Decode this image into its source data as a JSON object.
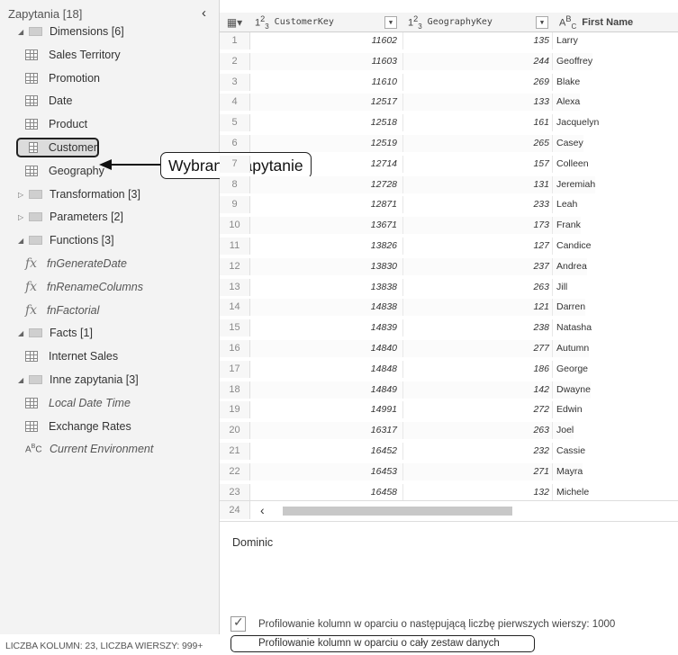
{
  "pane": {
    "title": "Zapytania [18]",
    "collapse_icon": "chevron-left-icon",
    "tree": [
      {
        "id": "dimensions",
        "label": "Dimensions [6]",
        "kind": "folder",
        "arrow": "expanded",
        "level": 0
      },
      {
        "id": "sales-territory",
        "label": "Sales Territory",
        "kind": "table",
        "level": 1
      },
      {
        "id": "promotion",
        "label": "Promotion",
        "kind": "table",
        "level": 1
      },
      {
        "id": "date",
        "label": "Date",
        "kind": "table",
        "level": 1
      },
      {
        "id": "product",
        "label": "Product",
        "kind": "table",
        "level": 1
      },
      {
        "id": "customer",
        "label": "Customer",
        "kind": "table",
        "level": 1,
        "selected": true
      },
      {
        "id": "geography",
        "label": "Geography",
        "kind": "table",
        "level": 1
      },
      {
        "id": "transformation",
        "label": "Transformation [3]",
        "kind": "folder",
        "arrow": "collapsed",
        "level": 0
      },
      {
        "id": "parameters",
        "label": "Parameters [2]",
        "kind": "folder",
        "arrow": "collapsed",
        "level": 0
      },
      {
        "id": "functions",
        "label": "Functions [3]",
        "kind": "folder",
        "arrow": "expanded",
        "level": 0
      },
      {
        "id": "fngeneratedate",
        "label": "fnGenerateDate",
        "kind": "function",
        "level": 1,
        "italic": true
      },
      {
        "id": "fnrenamecolumns",
        "label": "fnRenameColumns",
        "kind": "function",
        "level": 1,
        "italic": true
      },
      {
        "id": "fnfactorial",
        "label": "fnFactorial",
        "kind": "function",
        "level": 1,
        "italic": true
      },
      {
        "id": "facts",
        "label": "Facts [1]",
        "kind": "folder",
        "arrow": "expanded",
        "level": 0
      },
      {
        "id": "internet-sales",
        "label": "Internet Sales",
        "kind": "table",
        "level": 1
      },
      {
        "id": "inne-zapytania",
        "label": "Inne zapytania [3]",
        "kind": "folder",
        "arrow": "expanded",
        "level": 0
      },
      {
        "id": "local-date-time",
        "label": "Local Date Time",
        "kind": "table",
        "level": 1,
        "italic": true
      },
      {
        "id": "exchange-rates",
        "label": "Exchange Rates",
        "kind": "table",
        "level": 1
      },
      {
        "id": "current-environment",
        "label": "Current Environment",
        "kind": "text",
        "level": 1,
        "italic": true
      }
    ],
    "callout": "Wybrane zapytanie",
    "status": "LICZBA KOLUMN: 23, LICZBA WIERSZY: 999+"
  },
  "grid": {
    "columns": [
      {
        "type": "1²₃",
        "type_main": "1",
        "type_sup": "2",
        "type_sub": "3",
        "name": "CustomerKey"
      },
      {
        "type": "1²₃",
        "type_main": "1",
        "type_sup": "2",
        "type_sub": "3",
        "name": "GeographyKey"
      },
      {
        "type": "AᴮC",
        "type_main": "A",
        "type_sup": "B",
        "type_sub": "C",
        "name": "First Name"
      }
    ],
    "rows": [
      {
        "n": "1",
        "customer_key": "11602",
        "geography_key": "135",
        "first_name": "Larry"
      },
      {
        "n": "2",
        "customer_key": "11603",
        "geography_key": "244",
        "first_name": "Geoffrey"
      },
      {
        "n": "3",
        "customer_key": "11610",
        "geography_key": "269",
        "first_name": "Blake"
      },
      {
        "n": "4",
        "customer_key": "12517",
        "geography_key": "133",
        "first_name": "Alexa"
      },
      {
        "n": "5",
        "customer_key": "12518",
        "geography_key": "161",
        "first_name": "Jacquelyn"
      },
      {
        "n": "6",
        "customer_key": "12519",
        "geography_key": "265",
        "first_name": "Casey"
      },
      {
        "n": "7",
        "customer_key": "12714",
        "geography_key": "157",
        "first_name": "Colleen"
      },
      {
        "n": "8",
        "customer_key": "12728",
        "geography_key": "131",
        "first_name": "Jeremiah"
      },
      {
        "n": "9",
        "customer_key": "12871",
        "geography_key": "233",
        "first_name": "Leah"
      },
      {
        "n": "10",
        "customer_key": "13671",
        "geography_key": "173",
        "first_name": "Frank"
      },
      {
        "n": "11",
        "customer_key": "13826",
        "geography_key": "127",
        "first_name": "Candice"
      },
      {
        "n": "12",
        "customer_key": "13830",
        "geography_key": "237",
        "first_name": "Andrea"
      },
      {
        "n": "13",
        "customer_key": "13838",
        "geography_key": "263",
        "first_name": "Jill"
      },
      {
        "n": "14",
        "customer_key": "14838",
        "geography_key": "121",
        "first_name": "Darren"
      },
      {
        "n": "15",
        "customer_key": "14839",
        "geography_key": "238",
        "first_name": "Natasha"
      },
      {
        "n": "16",
        "customer_key": "14840",
        "geography_key": "277",
        "first_name": "Autumn"
      },
      {
        "n": "17",
        "customer_key": "14848",
        "geography_key": "186",
        "first_name": "George"
      },
      {
        "n": "18",
        "customer_key": "14849",
        "geography_key": "142",
        "first_name": "Dwayne"
      },
      {
        "n": "19",
        "customer_key": "14991",
        "geography_key": "272",
        "first_name": "Edwin"
      },
      {
        "n": "20",
        "customer_key": "16317",
        "geography_key": "263",
        "first_name": "Joel"
      },
      {
        "n": "21",
        "customer_key": "16452",
        "geography_key": "232",
        "first_name": "Cassie"
      },
      {
        "n": "22",
        "customer_key": "16453",
        "geography_key": "271",
        "first_name": "Mayra"
      },
      {
        "n": "23",
        "customer_key": "16458",
        "geography_key": "132",
        "first_name": "Michele"
      }
    ],
    "partial_row_number": "24",
    "scroll_left_icon": "chevron-left-icon"
  },
  "preview": {
    "text": "Dominic"
  },
  "profiling": {
    "option_top_n": "Profilowanie kolumn w oparciu o następującą liczbę pierwszych wierszy: 1000",
    "option_full": "Profilowanie kolumn w oparciu o cały zestaw danych",
    "checked_option": "option_top_n"
  }
}
